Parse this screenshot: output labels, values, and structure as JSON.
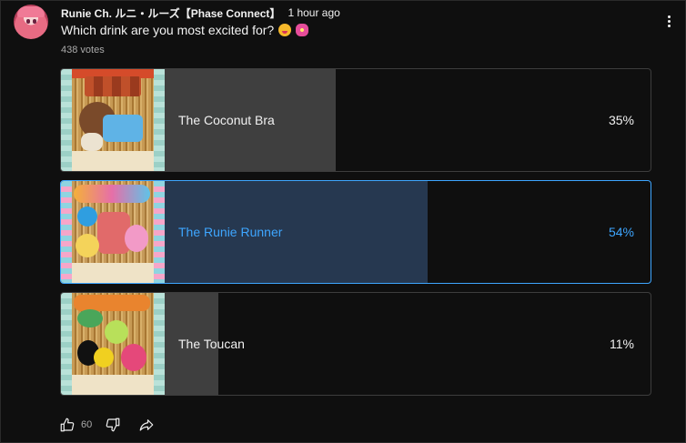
{
  "post": {
    "channel": "Runie Ch. ルニ・ルーズ【Phase Connect】",
    "time": "1 hour ago",
    "question": "Which drink are you most excited for?",
    "question_emojis": [
      "yum-face-emoji",
      "hibiscus-emoji"
    ],
    "votes": "438 votes"
  },
  "poll": {
    "options": [
      {
        "label": "The Coconut Bra",
        "percent_text": "35%",
        "percent": 35,
        "selected": false,
        "image": "coconut-drink-poster"
      },
      {
        "label": "The Runie Runner",
        "percent_text": "54%",
        "percent": 54,
        "selected": true,
        "image": "runie-runner-drink-poster"
      },
      {
        "label": "The Toucan",
        "percent_text": "11%",
        "percent": 11,
        "selected": false,
        "image": "toucan-drink-poster"
      }
    ]
  },
  "footer": {
    "like_count": "60",
    "icons": [
      "thumbs-up-icon",
      "thumbs-down-icon",
      "share-icon"
    ]
  },
  "colors": {
    "background": "#0f0f0f",
    "fill": "#3f3f3f",
    "selected_fill": "#263850",
    "accent": "#3ea6ff",
    "muted_text": "#aaaaaa"
  }
}
